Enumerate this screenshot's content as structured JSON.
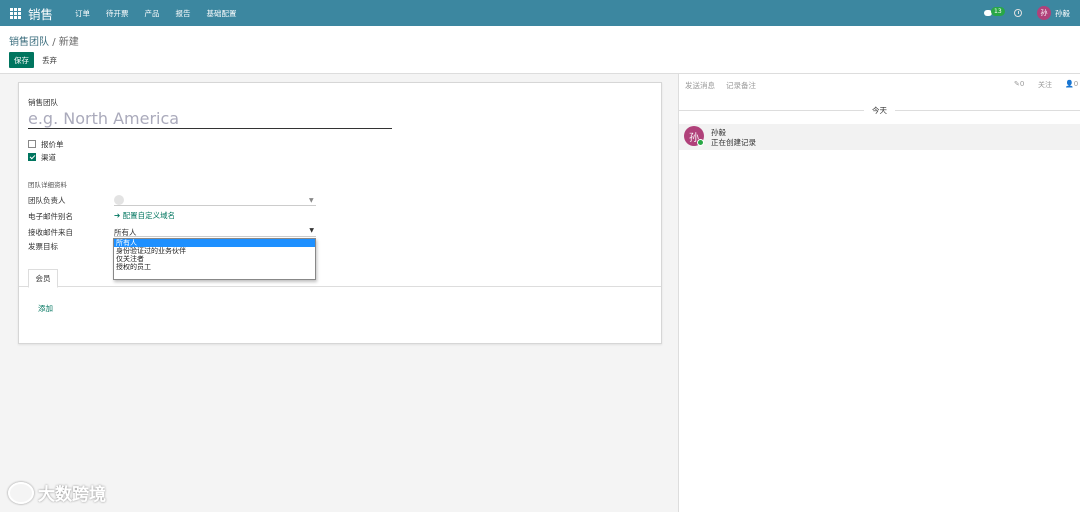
{
  "topbar": {
    "app_title": "销售",
    "menu": [
      "订单",
      "待开票",
      "产品",
      "报告",
      "基础配置"
    ],
    "message_count": "13",
    "avatar_letter": "孙",
    "user_name": "孙毅"
  },
  "breadcrumb": {
    "parent": "销售团队",
    "separator": "/",
    "current": "新建"
  },
  "actions": {
    "save": "保存",
    "discard": "丢弃"
  },
  "form": {
    "team_label": "销售团队",
    "name_placeholder": "e.g. North America",
    "checkboxes": [
      {
        "label": "报价单",
        "checked": false
      },
      {
        "label": "渠道",
        "checked": true
      }
    ],
    "section_title": "团队详细资料",
    "fields": {
      "leader_label": "团队负责人",
      "alias_label": "电子邮件别名",
      "alias_link": "➔ 配置自定义域名",
      "accept_label": "接收邮件来自",
      "accept_value": "所有人",
      "target_label": "发票目标"
    },
    "accept_options": [
      "所有人",
      "身份验证过的业务伙伴",
      "仅关注者",
      "授权的员工"
    ],
    "accept_selected_index": 0,
    "tab_members": "会员",
    "add_link": "添加"
  },
  "chatter": {
    "send_message": "发送消息",
    "log_note": "记录备注",
    "attachments": "✎0",
    "follow": "关注",
    "followers": "👤0",
    "today": "今天",
    "message": {
      "avatar_letter": "孙",
      "author": "孙毅",
      "body": "正在创建记录"
    }
  },
  "watermark": "大数跨境",
  "colors": {
    "topbar": "#3c87a0",
    "primary": "#00755f",
    "avatar": "#b0417a",
    "selected_option": "#1e90ff"
  }
}
